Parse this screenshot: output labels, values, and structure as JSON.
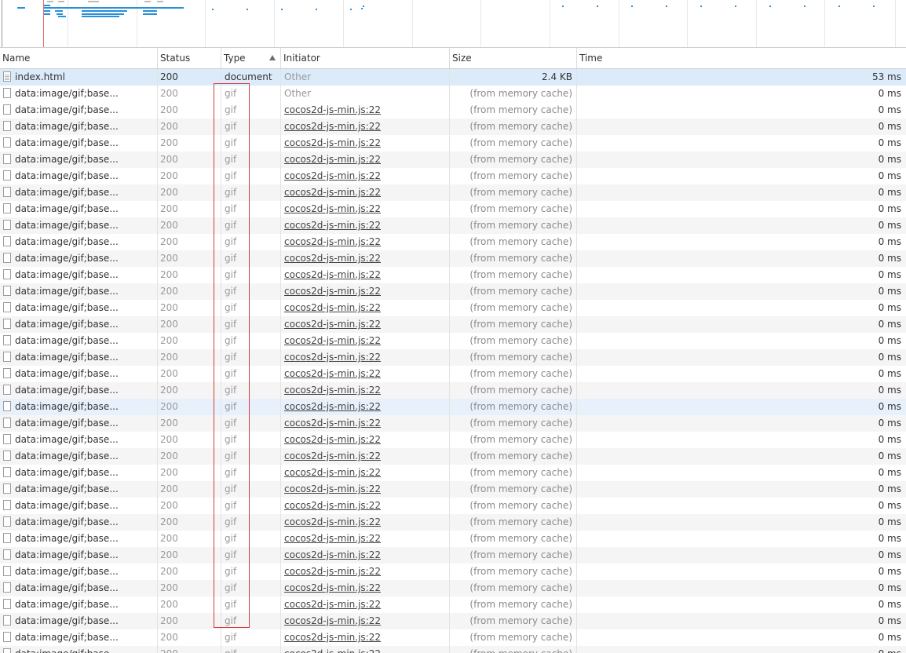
{
  "columns": [
    {
      "key": "name",
      "label": "Name"
    },
    {
      "key": "status",
      "label": "Status"
    },
    {
      "key": "type",
      "label": "Type"
    },
    {
      "key": "initiator",
      "label": "Initiator"
    },
    {
      "key": "size",
      "label": "Size"
    },
    {
      "key": "time",
      "label": "Time"
    }
  ],
  "sort": {
    "column": "type",
    "direction": "ascending",
    "icon": "sort-up-arrow-icon"
  },
  "first_row": {
    "name": "index.html",
    "status": "200",
    "type": "document",
    "initiator": "Other",
    "size": "2.4 KB",
    "time": "53 ms",
    "icon": "document-file-icon"
  },
  "second_row": {
    "name": "data:image/gif;base...",
    "status": "200",
    "type": "gif",
    "initiator": "Other",
    "size": "(from memory cache)",
    "time": "0 ms"
  },
  "repeated_row": {
    "name": "data:image/gif;base...",
    "status": "200",
    "type": "gif",
    "initiator": "cocos2d-js-min.js:22",
    "size": "(from memory cache)",
    "time": "0 ms",
    "icon": "blank-file-icon",
    "count": 35
  },
  "colors": {
    "selected_row": "#dcebfa",
    "hover_row": "#e8f1fb",
    "highlight_box": "#d63b3b",
    "overview_bars": "#2a8fd9",
    "load_line": "#e06a6a"
  }
}
